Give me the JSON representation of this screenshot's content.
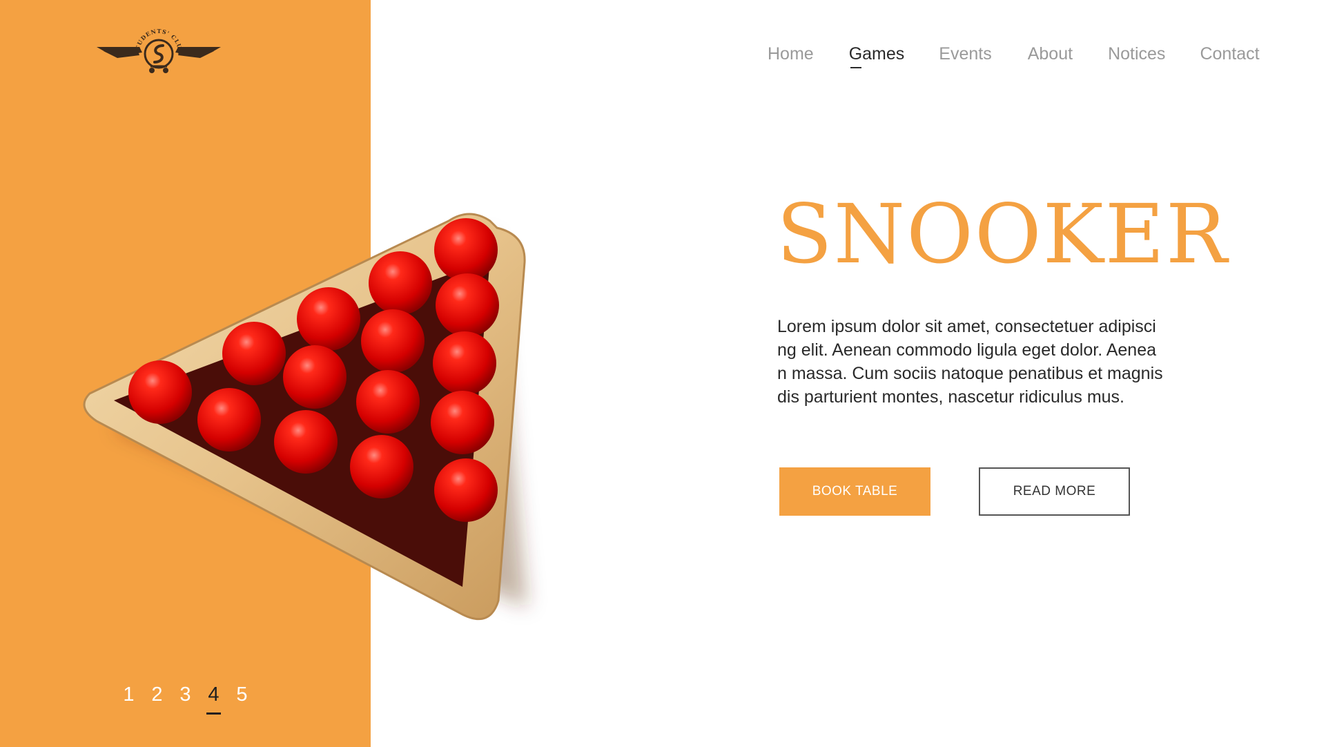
{
  "logo": {
    "text": "STUDENTS' CLUB"
  },
  "nav": {
    "items": [
      {
        "label": "Home"
      },
      {
        "label": "Games"
      },
      {
        "label": "Events"
      },
      {
        "label": "About"
      },
      {
        "label": "Notices"
      },
      {
        "label": "Contact"
      }
    ],
    "active": "Games"
  },
  "hero": {
    "title": "SNOOKER",
    "description": "Lorem ipsum dolor sit amet, consectetuer adipiscing elit. Aenean commodo ligula eget dolor. Aenean massa. Cum sociis natoque penatibus et magnis dis parturient montes, nascetur ridiculus mus.",
    "book_label": "BOOK TABLE",
    "read_more_label": "READ MORE"
  },
  "pagination": {
    "pages": [
      "1",
      "2",
      "3",
      "4",
      "5"
    ],
    "active": "4"
  },
  "colors": {
    "accent": "#F4A142",
    "ball": "#E10B0B",
    "wood": "#E9C893"
  },
  "image": {
    "subject": "snooker-balls-in-rack"
  }
}
